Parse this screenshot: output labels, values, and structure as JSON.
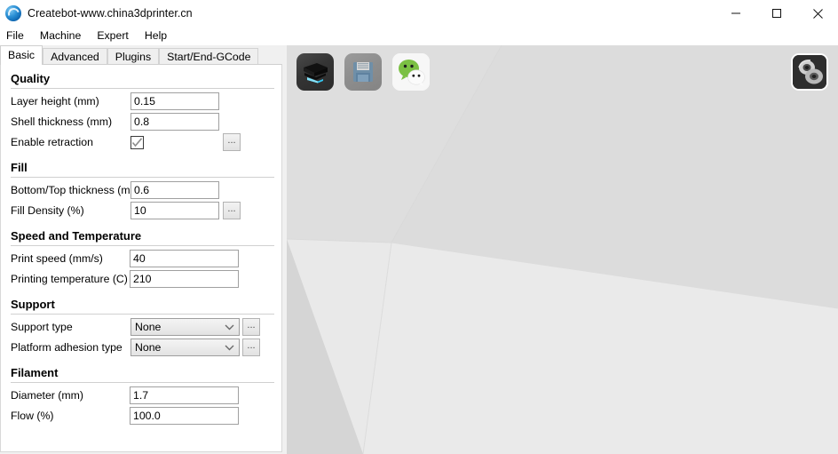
{
  "window": {
    "title": "Createbot-www.china3dprinter.cn",
    "app_icon": "globe-icon",
    "minimize_label": "Minimize",
    "maximize_label": "Maximize",
    "close_label": "Close"
  },
  "menubar": {
    "items": [
      {
        "label": "File"
      },
      {
        "label": "Machine"
      },
      {
        "label": "Expert"
      },
      {
        "label": "Help"
      }
    ]
  },
  "tabs": [
    {
      "label": "Basic",
      "active": true
    },
    {
      "label": "Advanced",
      "active": false
    },
    {
      "label": "Plugins",
      "active": false
    },
    {
      "label": "Start/End-GCode",
      "active": false
    }
  ],
  "settings": {
    "sections": [
      {
        "title": "Quality",
        "rows": [
          {
            "label": "Layer height (mm)",
            "value": "0.15",
            "control": "text"
          },
          {
            "label": "Shell thickness (mm)",
            "value": "0.8",
            "control": "text"
          },
          {
            "label": "Enable retraction",
            "value": "checked",
            "control": "checkbox",
            "dots": "..."
          }
        ]
      },
      {
        "title": "Fill",
        "rows": [
          {
            "label": "Bottom/Top thickness (mm)",
            "value": "0.6",
            "control": "text"
          },
          {
            "label": "Fill Density (%)",
            "value": "10",
            "control": "text",
            "dots": "..."
          }
        ]
      },
      {
        "title": "Speed and Temperature",
        "rows": [
          {
            "label": "Print speed (mm/s)",
            "value": "40",
            "control": "text"
          },
          {
            "label": "Printing temperature (C)",
            "value": "210",
            "control": "text"
          }
        ]
      },
      {
        "title": "Support",
        "rows": [
          {
            "label": "Support type",
            "value": "None",
            "control": "combo",
            "dots": "..."
          },
          {
            "label": "Platform adhesion type",
            "value": "None",
            "control": "combo",
            "dots": "..."
          }
        ]
      },
      {
        "title": "Filament",
        "rows": [
          {
            "label": "Diameter (mm)",
            "value": "1.7",
            "control": "text"
          },
          {
            "label": "Flow (%)",
            "value": "100.0",
            "control": "text"
          }
        ]
      }
    ]
  },
  "viewport": {
    "toolbar": [
      {
        "name": "load-model-icon",
        "label": "Load model"
      },
      {
        "name": "save-toolpath-icon",
        "label": "Save toolpath"
      },
      {
        "name": "wechat-icon",
        "label": "WeChat"
      }
    ],
    "view_button": {
      "name": "view-rotate-icon",
      "label": "View"
    }
  },
  "colors": {
    "accent": "#2a8fd4",
    "wechat_green": "#7bc043",
    "platform": "#e8e8e8",
    "wall": "#dcdcdc",
    "background": "#d5d5d5"
  }
}
